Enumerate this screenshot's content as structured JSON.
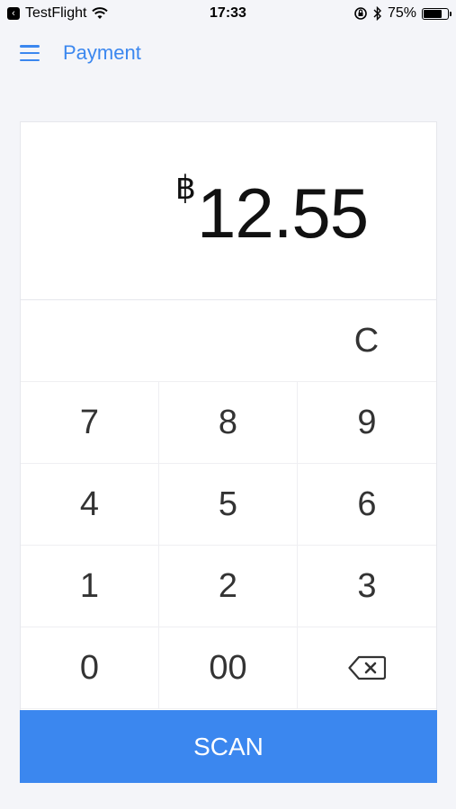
{
  "status_bar": {
    "carrier": "TestFlight",
    "time": "17:33",
    "battery_percent": "75%",
    "battery_level": 0.75
  },
  "nav": {
    "title": "Payment"
  },
  "amount": {
    "currency_symbol": "฿",
    "value": "12.55"
  },
  "keypad": {
    "clear_label": "C",
    "keys": [
      "7",
      "8",
      "9",
      "4",
      "5",
      "6",
      "1",
      "2",
      "3",
      "0",
      "00"
    ]
  },
  "actions": {
    "scan_label": "SCAN"
  },
  "colors": {
    "accent": "#3b87ef",
    "background": "#f4f5f9"
  }
}
